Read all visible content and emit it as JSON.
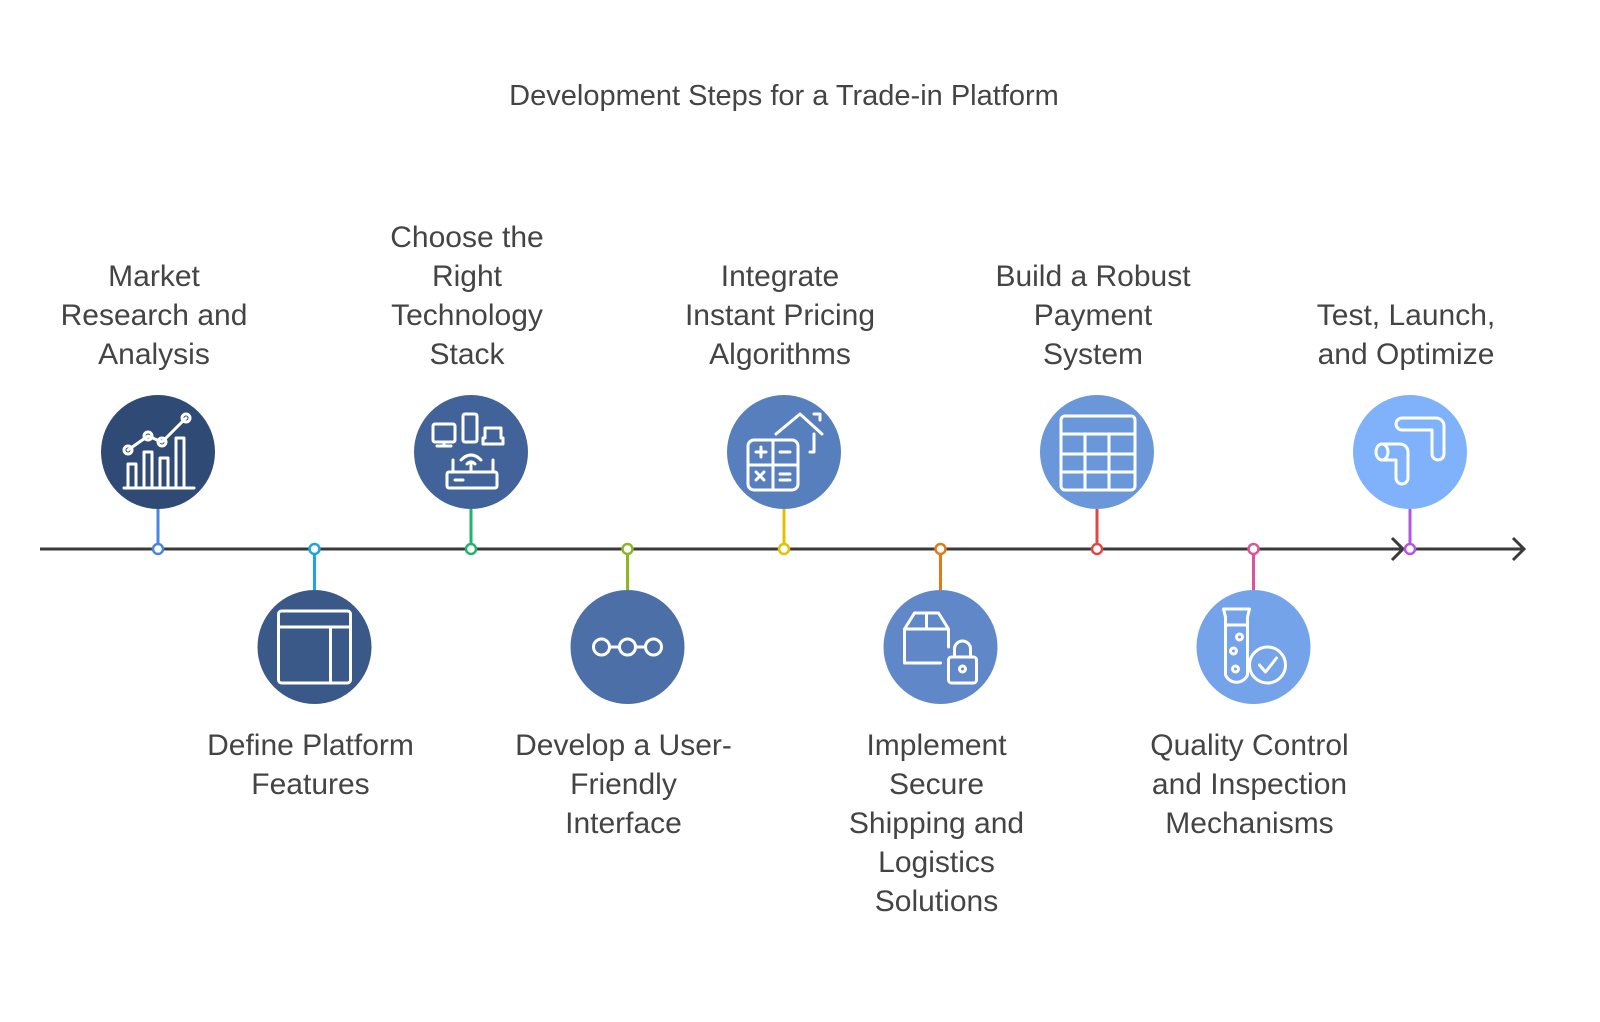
{
  "title": "Development Steps for a Trade-in Platform",
  "steps": [
    {
      "label": [
        "Market",
        "Research and",
        "Analysis"
      ],
      "position": "top",
      "icon": "chart-growth-icon",
      "fill": "#2f4a75",
      "stem": "#4a86e0"
    },
    {
      "label": [
        "Define Platform",
        "Features"
      ],
      "position": "bottom",
      "icon": "layout-icon",
      "fill": "#3a5888",
      "stem": "#1aa7e0"
    },
    {
      "label": [
        "Choose the",
        "Right",
        "Technology",
        "Stack"
      ],
      "position": "top",
      "icon": "devices-router-icon",
      "fill": "#42639a",
      "stem": "#22b36e"
    },
    {
      "label": [
        "Develop a User-",
        "Friendly",
        "Interface"
      ],
      "position": "bottom",
      "icon": "flow-nodes-icon",
      "fill": "#4d6fa8",
      "stem": "#8ab81d"
    },
    {
      "label": [
        "Integrate",
        "Instant Pricing",
        "Algorithms"
      ],
      "position": "top",
      "icon": "calculator-house-icon",
      "fill": "#587fbd",
      "stem": "#e0c200"
    },
    {
      "label": [
        "Implement",
        "Secure",
        "Shipping and",
        "Logistics",
        "Solutions"
      ],
      "position": "bottom",
      "icon": "box-lock-icon",
      "fill": "#6088c9",
      "stem": "#e07b1a"
    },
    {
      "label": [
        "Build a Robust",
        "Payment",
        "System"
      ],
      "position": "top",
      "icon": "table-grid-icon",
      "fill": "#6a97d9",
      "stem": "#e04848"
    },
    {
      "label": [
        "Quality Control",
        "and Inspection",
        "Mechanisms"
      ],
      "position": "bottom",
      "icon": "test-tube-check-icon",
      "fill": "#74a3ea",
      "stem": "#d955a0"
    },
    {
      "label": [
        "Test, Launch,",
        "and Optimize"
      ],
      "position": "top",
      "icon": "pipeline-icon",
      "fill": "#7fb2fb",
      "stem": "#b455e0"
    }
  ],
  "timeline_color": "#3a3a3a"
}
